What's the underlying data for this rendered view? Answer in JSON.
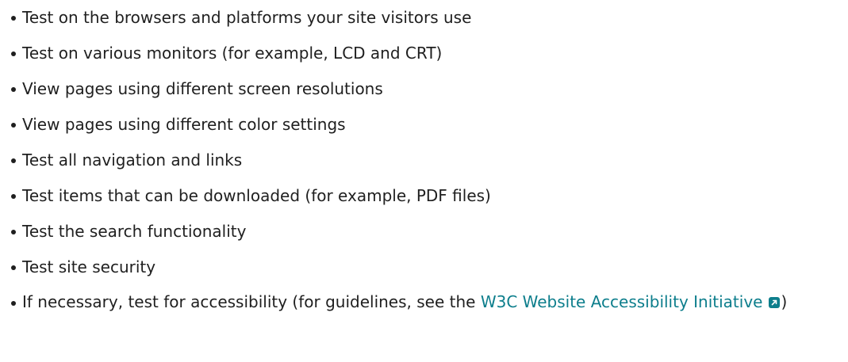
{
  "checklist": {
    "items": [
      "Test on the browsers and platforms your site visitors use",
      "Test on various monitors (for example, LCD and CRT)",
      "View pages using different screen resolutions",
      "View pages using different color settings",
      "Test all navigation and links",
      "Test items that can be downloaded (for example, PDF files)",
      "Test the search functionality",
      "Test site security"
    ],
    "last_item": {
      "prefix": "If necessary, test for accessibility (for guidelines, see the ",
      "link_text": "W3C Website Accessibility Initiative",
      "suffix": ")",
      "link_icon": "external-link-icon"
    }
  },
  "colors": {
    "text": "#1f1f1f",
    "link": "#0d7e8c",
    "background": "#ffffff"
  }
}
